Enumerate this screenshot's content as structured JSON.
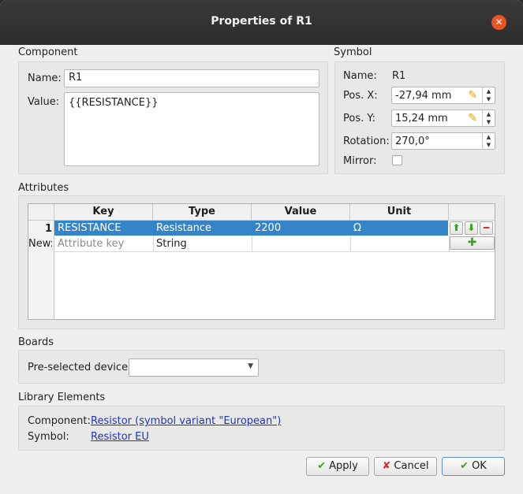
{
  "window": {
    "title": "Properties of R1",
    "close_glyph": "✕"
  },
  "component": {
    "label": "Component",
    "name_label": "Name:",
    "name_value": "R1",
    "value_label": "Value:",
    "value_value": "{{RESISTANCE}}"
  },
  "symbol": {
    "label": "Symbol",
    "name_label": "Name:",
    "name_value": "R1",
    "posx_label": "Pos. X:",
    "posx_value": "-27,94 mm",
    "posy_label": "Pos. Y:",
    "posy_value": "15,24 mm",
    "rotation_label": "Rotation:",
    "rotation_value": "270,0°",
    "mirror_label": "Mirror:",
    "mirror_checked": false
  },
  "attributes": {
    "label": "Attributes",
    "columns": [
      "Key",
      "Type",
      "Value",
      "Unit"
    ],
    "rows": [
      {
        "index": "1",
        "key": "RESISTANCE",
        "type": "Resistance",
        "value": "2200",
        "unit": "Ω"
      }
    ],
    "new_row": {
      "index": "New:",
      "key_placeholder": "Attribute key",
      "type": "String"
    }
  },
  "boards": {
    "label": "Boards",
    "device_label": "Pre-selected device:",
    "device_value": ""
  },
  "library": {
    "label": "Library Elements",
    "component_label": "Component:",
    "component_link": "Resistor (symbol variant \"European\")",
    "symbol_label": "Symbol:",
    "symbol_link": "Resistor EU"
  },
  "buttons": {
    "apply": "Apply",
    "cancel": "Cancel",
    "ok": "OK"
  },
  "icons": {
    "up": "arrow-up-icon",
    "down": "arrow-down-icon",
    "remove": "minus-icon",
    "add": "plus-icon",
    "pencil": "pencil-icon",
    "check": "check-icon",
    "cross": "cross-icon"
  },
  "colors": {
    "accent": "#e95420",
    "selection": "#3584c8",
    "link": "#1a35c8",
    "green": "#3aa51a",
    "red": "#d03030"
  }
}
